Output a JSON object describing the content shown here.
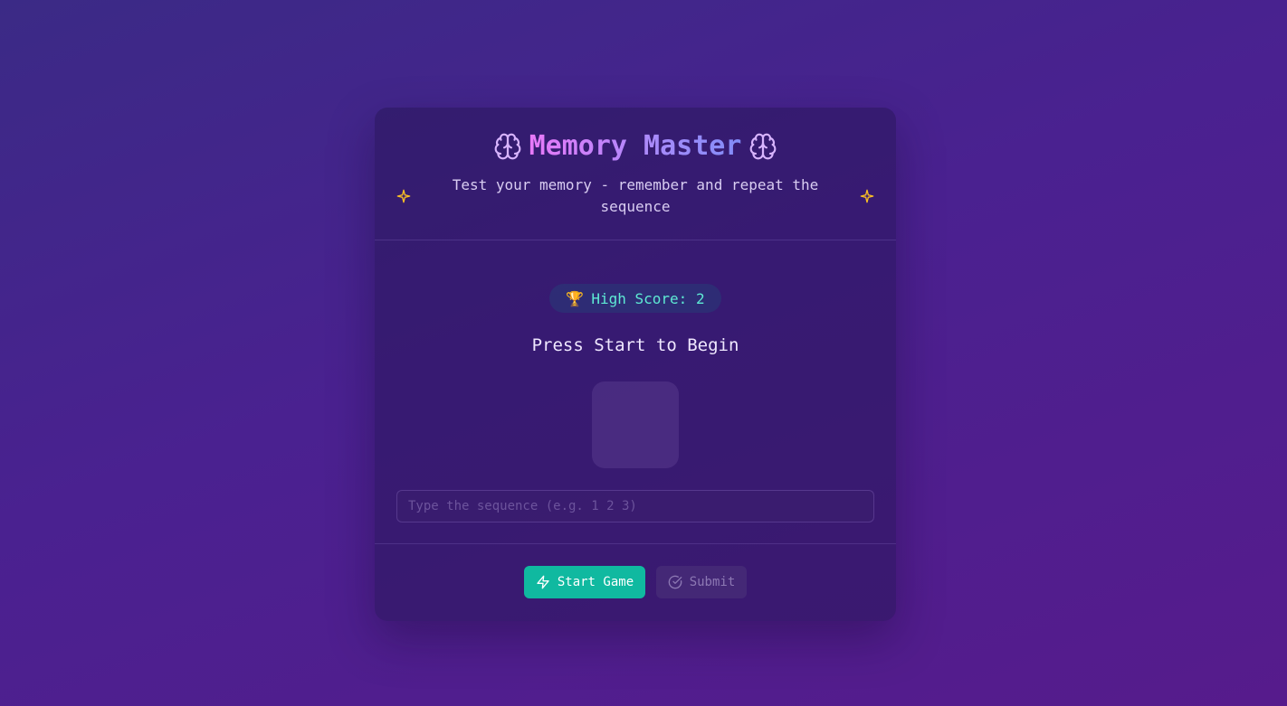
{
  "header": {
    "title": "Memory Master",
    "subtitle": "Test your memory - remember and repeat the sequence",
    "left_icon": "brain-icon",
    "right_icon": "brain-icon",
    "sparkle_icon": "sparkle-icon"
  },
  "game": {
    "high_score_label": "High Score: 2",
    "trophy_icon": "🏆",
    "status": "Press Start to Begin",
    "input_placeholder": "Type the sequence (e.g. 1 2 3)",
    "input_value": ""
  },
  "actions": {
    "start_label": "Start Game",
    "submit_label": "Submit",
    "start_icon": "lightning-icon",
    "submit_icon": "check-circle-icon"
  },
  "colors": {
    "accent": "#10b9a0",
    "score": "#5eead4",
    "title_gradient_start": "#e879f9",
    "title_gradient_end": "#818cf8",
    "sparkle": "#fbbf24"
  }
}
